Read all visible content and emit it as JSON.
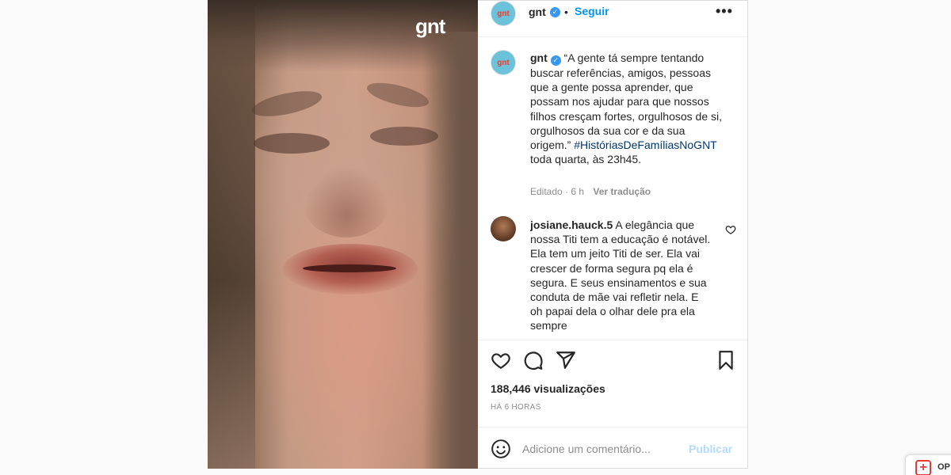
{
  "media": {
    "logo_text": "gnt"
  },
  "header": {
    "avatar_text": "gnt",
    "username": "gnt",
    "verified_icon": "verified-badge-icon",
    "separator": "•",
    "follow_label": "Seguir",
    "more_label": "•••"
  },
  "caption": {
    "avatar_text": "gnt",
    "username": "gnt",
    "text": "“A gente tá sempre tentando buscar referências, amigos, pessoas que a gente possa aprender, que possam nos ajudar para que nossos filhos cresçam fortes, orgulhosos de si, orgulhosos da sua cor e da sua origem.”",
    "hashtag": "#HistóriasDeFamíliasNoGNT",
    "tail": "toda quarta, às 23h45.",
    "edited": "Editado · 6 h",
    "translate_label": "Ver tradução"
  },
  "comment": {
    "username": "josiane.hauck.5",
    "text": "A elegância que nossa Titi tem a educação é notável. Ela tem um jeito Titi de ser. Ela vai crescer de forma segura pq ela é segura. E seus ensinamentos e sua conduta de mãe vai refletir nela. E oh papai dela o olhar dele pra ela sempre"
  },
  "actions": {
    "icons": [
      "heart-icon",
      "comment-icon",
      "share-icon",
      "bookmark-icon"
    ]
  },
  "stats": {
    "views": "188,446 visualizações",
    "time_ago": "HÁ 6 HORAS"
  },
  "add_comment": {
    "placeholder": "Adicione um comentário...",
    "publish_label": "Publicar"
  },
  "widget": {
    "label": "OP"
  },
  "colors": {
    "accent": "#0095f6",
    "hashtag": "#00376b",
    "publish_disabled": "#b3dbff",
    "avatar_bg": "#6cc2da"
  }
}
